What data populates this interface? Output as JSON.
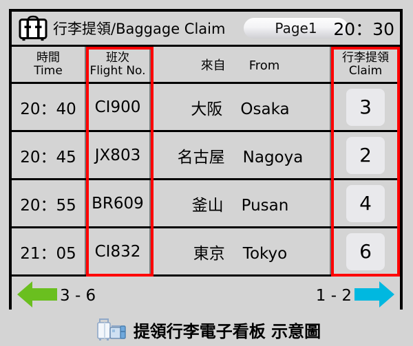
{
  "header": {
    "icon": "suitcase-icon",
    "title": "行李提領/Baggage Claim",
    "page_label": "Page1",
    "clock": "20：30"
  },
  "table": {
    "columns": [
      {
        "key": "time",
        "zh": "時間",
        "en": "Time"
      },
      {
        "key": "flight",
        "zh": "班次",
        "en": "Flight  No."
      },
      {
        "key": "from",
        "zh": "來自",
        "en": "From"
      },
      {
        "key": "claim",
        "zh": "行李提領",
        "en": "Claim"
      }
    ],
    "rows": [
      {
        "time": "20：40",
        "flight": "CI900",
        "from_zh": "大阪",
        "from_en": "Osaka",
        "claim": "3"
      },
      {
        "time": "20：45",
        "flight": "JX803",
        "from_zh": "名古屋",
        "from_en": "Nagoya",
        "claim": "2"
      },
      {
        "time": "20：55",
        "flight": "BR609",
        "from_zh": "釜山",
        "from_en": "Pusan",
        "claim": "4"
      },
      {
        "time": "21：05",
        "flight": "CI832",
        "from_zh": "東京",
        "from_en": "Tokyo",
        "claim": "6"
      }
    ]
  },
  "footer": {
    "prev_label": "3 - 6",
    "next_label": "1 - 2",
    "prev_arrow_color": "#6abf1f",
    "next_arrow_color": "#00b8e0"
  },
  "caption": {
    "text": "提領行李電子看板 示意圖",
    "icon": "luggage-icon"
  },
  "colors": {
    "background": "#d4d4d4",
    "border": "#000000",
    "highlight": "#ff0000",
    "chip": "#e9e9ec"
  }
}
